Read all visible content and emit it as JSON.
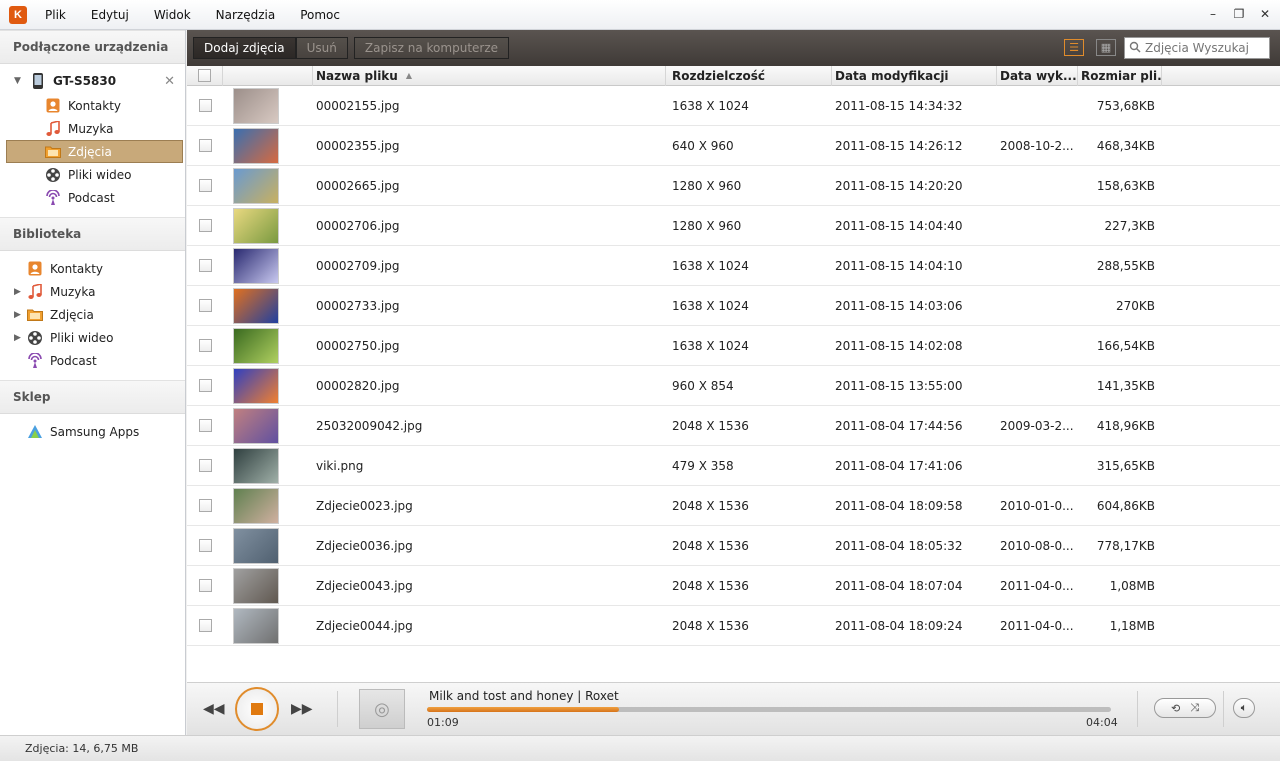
{
  "app": {
    "logo": "Kies"
  },
  "menu": [
    "Plik",
    "Edytuj",
    "Widok",
    "Narzędzia",
    "Pomoc"
  ],
  "window_controls": {
    "minimize": "–",
    "restore": "❐",
    "close": "✕"
  },
  "sidebar": {
    "connected_title": "Podłączone urządzenia",
    "device": "GT-S5830",
    "device_items": [
      "Kontakty",
      "Muzyka",
      "Zdjęcia",
      "Pliki wideo",
      "Podcast"
    ],
    "selected_device_item": "Zdjęcia",
    "library_title": "Biblioteka",
    "library_items": [
      "Kontakty",
      "Muzyka",
      "Zdjęcia",
      "Pliki wideo",
      "Podcast"
    ],
    "shop_title": "Sklep",
    "shop_items": [
      "Samsung Apps"
    ]
  },
  "toolbar": {
    "add_label": "Dodaj zdjęcia",
    "delete_label": "Usuń",
    "save_label": "Zapisz na komputerze",
    "search_placeholder": "Zdjęcia Wyszukaj"
  },
  "table": {
    "columns": [
      "Nazwa pliku",
      "Rozdzielczość",
      "Data modyfikacji",
      "Data wyk...",
      "Rozmiar pli..."
    ],
    "sort_indicator": "▲",
    "rows": [
      {
        "name": "00002155.jpg",
        "res": "1638 X 1024",
        "mod": "2011-08-15 14:34:32",
        "taken": "",
        "size": "753,68KB",
        "c1": "#9c8f8a",
        "c2": "#d8c9c2"
      },
      {
        "name": "00002355.jpg",
        "res": "640 X 960",
        "mod": "2011-08-15 14:26:12",
        "taken": "2008-10-2...",
        "size": "468,34KB",
        "c1": "#3a6fb0",
        "c2": "#d66a40"
      },
      {
        "name": "00002665.jpg",
        "res": "1280 X 960",
        "mod": "2011-08-15 14:20:20",
        "taken": "",
        "size": "158,63KB",
        "c1": "#6a9ad0",
        "c2": "#c8b060"
      },
      {
        "name": "00002706.jpg",
        "res": "1280 X 960",
        "mod": "2011-08-15 14:04:40",
        "taken": "",
        "size": "227,3KB",
        "c1": "#e8d880",
        "c2": "#7a9a40"
      },
      {
        "name": "00002709.jpg",
        "res": "1638 X 1024",
        "mod": "2011-08-15 14:04:10",
        "taken": "",
        "size": "288,55KB",
        "c1": "#2a2a70",
        "c2": "#c8c8f0"
      },
      {
        "name": "00002733.jpg",
        "res": "1638 X 1024",
        "mod": "2011-08-15 14:03:06",
        "taken": "",
        "size": "270KB",
        "c1": "#e07020",
        "c2": "#2040a0"
      },
      {
        "name": "00002750.jpg",
        "res": "1638 X 1024",
        "mod": "2011-08-15 14:02:08",
        "taken": "",
        "size": "166,54KB",
        "c1": "#3a6a20",
        "c2": "#b0d060"
      },
      {
        "name": "00002820.jpg",
        "res": "960 X 854",
        "mod": "2011-08-15 13:55:00",
        "taken": "",
        "size": "141,35KB",
        "c1": "#3040c0",
        "c2": "#f08030"
      },
      {
        "name": "25032009042.jpg",
        "res": "2048 X 1536",
        "mod": "2011-08-04 17:44:56",
        "taken": "2009-03-2...",
        "size": "418,96KB",
        "c1": "#c08080",
        "c2": "#6050a0"
      },
      {
        "name": "viki.png",
        "res": "479 X 358",
        "mod": "2011-08-04 17:41:06",
        "taken": "",
        "size": "315,65KB",
        "c1": "#304040",
        "c2": "#a0b0a8"
      },
      {
        "name": "Zdjecie0023.jpg",
        "res": "2048 X 1536",
        "mod": "2011-08-04 18:09:58",
        "taken": "2010-01-0...",
        "size": "604,86KB",
        "c1": "#608050",
        "c2": "#d0b0a0"
      },
      {
        "name": "Zdjecie0036.jpg",
        "res": "2048 X 1536",
        "mod": "2011-08-04 18:05:32",
        "taken": "2010-08-0...",
        "size": "778,17KB",
        "c1": "#8090a0",
        "c2": "#506070"
      },
      {
        "name": "Zdjecie0043.jpg",
        "res": "2048 X 1536",
        "mod": "2011-08-04 18:07:04",
        "taken": "2011-04-0...",
        "size": "1,08MB",
        "c1": "#a0a0a0",
        "c2": "#605850"
      },
      {
        "name": "Zdjecie0044.jpg",
        "res": "2048 X 1536",
        "mod": "2011-08-04 18:09:24",
        "taken": "2011-04-0...",
        "size": "1,18MB",
        "c1": "#b0b8c0",
        "c2": "#707070"
      }
    ]
  },
  "player": {
    "track": "Milk and tost and honey | Roxet",
    "current_time": "01:09",
    "total_time": "04:04",
    "progress": 0.28
  },
  "status": "Zdjęcia: 14, 6,75 MB"
}
